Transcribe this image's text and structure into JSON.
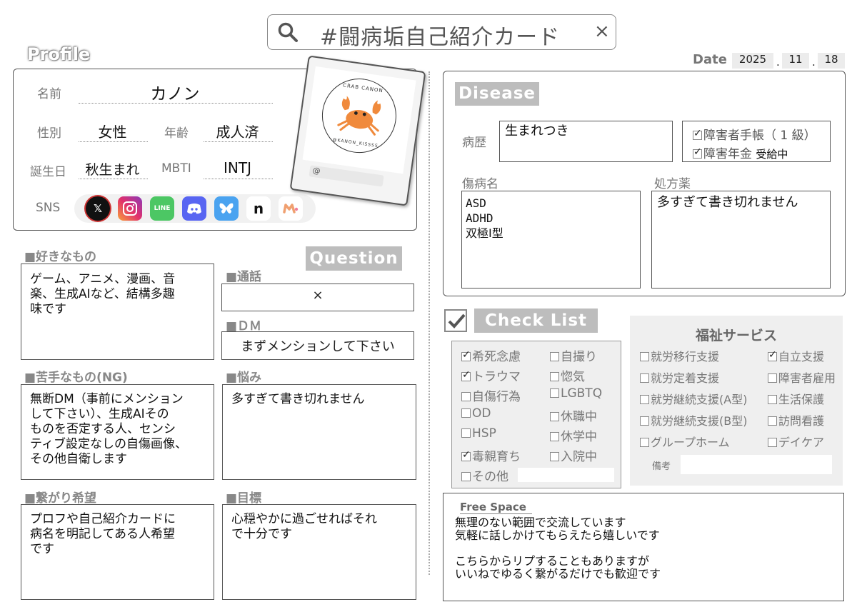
{
  "search": {
    "text": "#闘病垢自己紹介カード",
    "close": "×"
  },
  "date": {
    "label": "Date",
    "year": "2025",
    "month": "11",
    "day": "18",
    "sep": "."
  },
  "profile": {
    "title": "Profile",
    "name_label": "名前",
    "name": "カノン",
    "gender_label": "性別",
    "gender": "女性",
    "age_label": "年齢",
    "age": "成人済",
    "birthday_label": "誕生日",
    "birthday": "秋生まれ",
    "mbti_label": "MBTI",
    "mbti": "INTJ",
    "sns_label": "SNS",
    "sns": [
      "X",
      "Instagram",
      "LINE",
      "Discord",
      "Bluesky",
      "note",
      "Misskey"
    ],
    "card": {
      "logo_top": "CRAB CANON",
      "logo_bottom": "@KANON_KISSSS",
      "at": "@"
    }
  },
  "question": {
    "title": "Question",
    "likes_label": "■好きなもの",
    "likes": "ゲーム、アニメ、漫画、音\n楽、生成AIなど、結構多趣\n味です",
    "call_label": "■通話",
    "call": "×",
    "dm_label": "■ＤＭ",
    "dm": "まずメンションして下さい",
    "ng_label": "■苦手なもの(NG)",
    "ng": "無断DM（事前にメンション\nして下さい）、生成AIその\nものを否定する人、センシ\nティブ設定なしの自傷画像、\nその他自衛します",
    "worry_label": "■悩み",
    "worry": "多すぎて書き切れません",
    "connect_label": "■繋がり希望",
    "connect": "プロフや自己紹介カードに\n病名を明記してある人希望\nです",
    "goal_label": "■目標",
    "goal": "心穏やかに過ごせればそれ\nで十分です"
  },
  "disease": {
    "title": "Disease",
    "history_label": "病歴",
    "history": "生まれつき",
    "techo": "障害者手帳（ 1 級）",
    "pension": "障害年金",
    "pension_status": "受給中",
    "names_label": "傷病名",
    "names": "ASD\nADHD\n双極Ⅰ型",
    "meds_label": "処方薬",
    "meds": "多すぎて書き切れません"
  },
  "checklist": {
    "title": "Check List",
    "items": [
      {
        "label": "希死念慮",
        "checked": true
      },
      {
        "label": "自撮り",
        "checked": false
      },
      {
        "label": "トラウマ",
        "checked": true
      },
      {
        "label": "惚気",
        "checked": false
      },
      {
        "label": "自傷行為",
        "checked": false
      },
      {
        "label": "LGBTQ",
        "checked": false
      },
      {
        "label": "OD",
        "checked": false
      },
      {
        "label": "休職中",
        "checked": false
      },
      {
        "label": "HSP",
        "checked": false
      },
      {
        "label": "休学中",
        "checked": false
      },
      {
        "label": "毒親育ち",
        "checked": true
      },
      {
        "label": "入院中",
        "checked": false
      },
      {
        "label": "その他",
        "checked": false
      }
    ]
  },
  "welfare": {
    "title": "福祉サービス",
    "items": [
      {
        "label": "就労移行支援",
        "checked": false
      },
      {
        "label": "自立支援",
        "checked": true
      },
      {
        "label": "就労定着支援",
        "checked": false
      },
      {
        "label": "障害者雇用",
        "checked": false
      },
      {
        "label": "就労継続支援(A型)",
        "checked": false
      },
      {
        "label": "生活保護",
        "checked": false
      },
      {
        "label": "就労継続支援(B型)",
        "checked": false
      },
      {
        "label": "訪問看護",
        "checked": false
      },
      {
        "label": "グループホーム",
        "checked": false
      },
      {
        "label": "デイケア",
        "checked": false
      }
    ],
    "note_label": "備考"
  },
  "free": {
    "title": "Free Space",
    "text": "無理のない範囲で交流しています\n気軽に話しかけてもらえたら嬉しいです\n\nこちらからリプすることもありますが\nいいねでゆるく繋がるだけでも歓迎です"
  }
}
